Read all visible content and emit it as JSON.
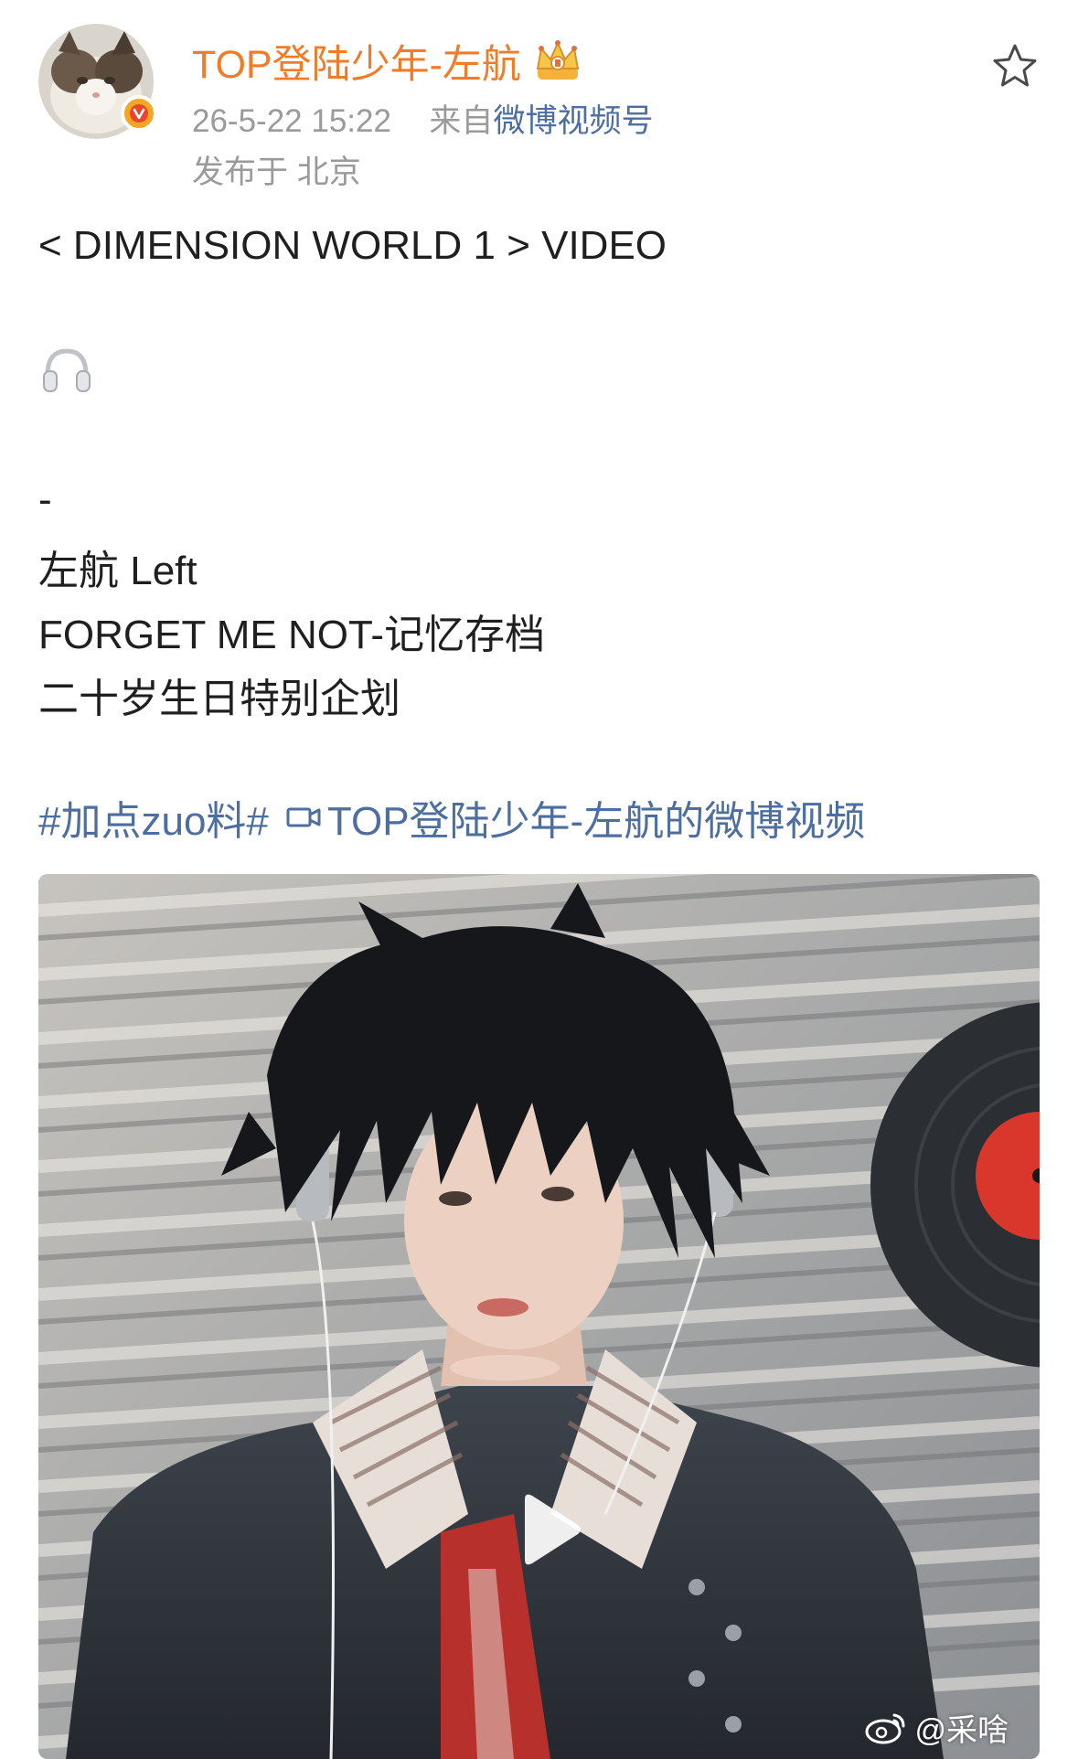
{
  "header": {
    "author_name": "TOP登陆少年-左航",
    "timestamp": "26-5-22 15:22",
    "source_prefix": "来自",
    "source_name": "微博视频号",
    "location": "发布于 北京"
  },
  "icons": {
    "avatar": "cat-avatar",
    "verified": "verified-badge-icon",
    "crown": "crown-icon",
    "favorite": "star-icon",
    "emoji": "headphones-icon",
    "video_link": "video-camera-icon",
    "play": "play-icon",
    "watermark": "weibo-icon"
  },
  "post": {
    "line1": "< DIMENSION WORLD 1 > VIDEO",
    "dash": "-",
    "line2": "左航 Left",
    "line3": "FORGET ME NOT-记忆存档",
    "line4": "二十岁生日特别企划",
    "hashtag": "#加点zuo料#",
    "video_link_label": "TOP登陆少年-左航的微博视频"
  },
  "media": {
    "watermark_text": "@采啥"
  },
  "colors": {
    "author": "#f07c2a",
    "link": "#4d6ea0",
    "meta": "#9a9a9a",
    "text": "#1f1f1f",
    "badge": "#f5a623"
  }
}
